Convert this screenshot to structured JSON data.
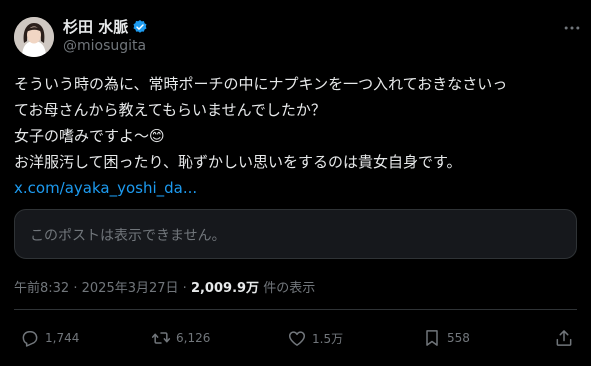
{
  "author": {
    "display_name": "杉田 水脈",
    "handle": "@miosugita",
    "verified_icon": "verified-badge-icon",
    "badge_color": "#1d9bf0"
  },
  "tweet": {
    "lines": [
      "そういう時の為に、常時ポーチの中にナプキンを一つ入れておきなさいっ",
      "てお母さんから教えてもらいませんでしたか？",
      "女子の嗜みですよ〜😊",
      "お洋服汚して困ったり、恥ずかしい思いをするのは貴女自身です。"
    ],
    "link": "x.com/ayaka_yoshi_da..."
  },
  "quoted_card": {
    "text": "このポストは表示できません。"
  },
  "meta": {
    "time": "午前8:32",
    "date": "2025年3月27日",
    "separator": "·",
    "views_count": "2,009.9万",
    "views_label": "件の表示"
  },
  "actions": {
    "replies": "1,744",
    "reposts": "6,126",
    "likes": "1.5万",
    "bookmarks": "558"
  },
  "colors": {
    "background": "#000000",
    "text": "#e7e9ea",
    "secondary": "#71767b",
    "link": "#1d9bf0",
    "border": "#2f3336"
  }
}
